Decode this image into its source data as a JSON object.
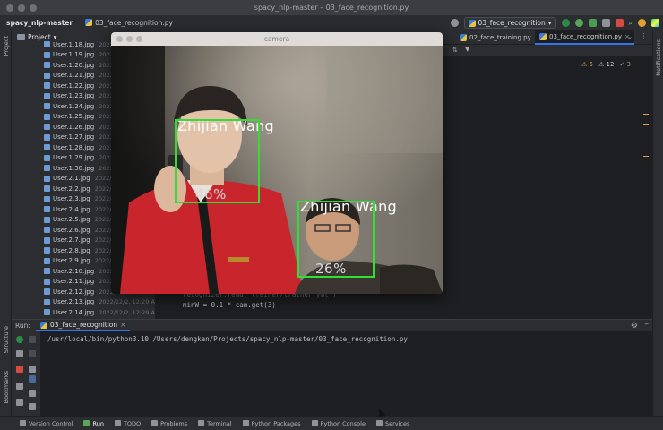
{
  "window": {
    "title": "spacy_nlp-master – 03_face_recognition.py"
  },
  "navbar": {
    "project": "spacy_nlp-master",
    "file": "03_face_recognition.py",
    "run_config": "03_face_recognition"
  },
  "sidebar": {
    "project_label": "Project",
    "structure_label": "Structure",
    "bookmarks_label": "Bookmarks",
    "notifications_label": "Notifications"
  },
  "files": [
    {
      "name": "User.1.18.jpg",
      "date": "2022/"
    },
    {
      "name": "User.1.19.jpg",
      "date": "2022/"
    },
    {
      "name": "User.1.20.jpg",
      "date": "2022/"
    },
    {
      "name": "User.1.21.jpg",
      "date": "2022/"
    },
    {
      "name": "User.1.22.jpg",
      "date": "2022/"
    },
    {
      "name": "User.1.23.jpg",
      "date": "2022/"
    },
    {
      "name": "User.1.24.jpg",
      "date": "2022/"
    },
    {
      "name": "User.1.25.jpg",
      "date": "2022/"
    },
    {
      "name": "User.1.26.jpg",
      "date": "2022/"
    },
    {
      "name": "User.1.27.jpg",
      "date": "2022/"
    },
    {
      "name": "User.1.28.jpg",
      "date": "2022/"
    },
    {
      "name": "User.1.29.jpg",
      "date": "2022/"
    },
    {
      "name": "User.1.30.jpg",
      "date": "2022/"
    },
    {
      "name": "User.2.1.jpg",
      "date": "2022/"
    },
    {
      "name": "User.2.2.jpg",
      "date": "2022/"
    },
    {
      "name": "User.2.3.jpg",
      "date": "2022/"
    },
    {
      "name": "User.2.4.jpg",
      "date": "2022/"
    },
    {
      "name": "User.2.5.jpg",
      "date": "2022/"
    },
    {
      "name": "User.2.6.jpg",
      "date": "2022/"
    },
    {
      "name": "User.2.7.jpg",
      "date": "2022/"
    },
    {
      "name": "User.2.8.jpg",
      "date": "2022/"
    },
    {
      "name": "User.2.9.jpg",
      "date": "2022/"
    },
    {
      "name": "User.2.10.jpg",
      "date": "2022/"
    },
    {
      "name": "User.2.11.jpg",
      "date": "2022/"
    },
    {
      "name": "User.2.12.jpg",
      "date": "2022/12/2, 12:29 AM"
    },
    {
      "name": "User.2.13.jpg",
      "date": "2022/12/2, 12:29 AM"
    },
    {
      "name": "User.2.14.jpg",
      "date": "2022/12/2, 12:29 AM"
    }
  ],
  "editor": {
    "tabs": [
      {
        "label": "02_face_training.py",
        "active": false
      },
      {
        "label": "03_face_recognition.py",
        "active": true
      }
    ],
    "inspections": {
      "warnings": "5",
      "weak": "12",
      "typos": "3"
    },
    "code_line_1": "recognizer.read('trainer/trainer.yml')",
    "code_line_2": "minW = 0.1 * cam.get(3)"
  },
  "camera": {
    "title": "camera",
    "faces": [
      {
        "name": "Zhijian Wang",
        "confidence": "46%"
      },
      {
        "name": "Zhijian Wang",
        "confidence": "26%"
      }
    ]
  },
  "run": {
    "label": "Run:",
    "tab": "03_face_recognition",
    "console": "/usr/local/bin/python3.10 /Users/dengkan/Projects/spacy_nlp-master/03_face_recognition.py"
  },
  "statusbar": {
    "items": [
      "Version Control",
      "Run",
      "TODO",
      "Problems",
      "Terminal",
      "Python Packages",
      "Python Console",
      "Services"
    ]
  },
  "colors": {
    "accent": "#3574f0",
    "face_box": "#33dd33",
    "ide_bg": "#2b2d30",
    "editor_bg": "#1e1f22"
  }
}
